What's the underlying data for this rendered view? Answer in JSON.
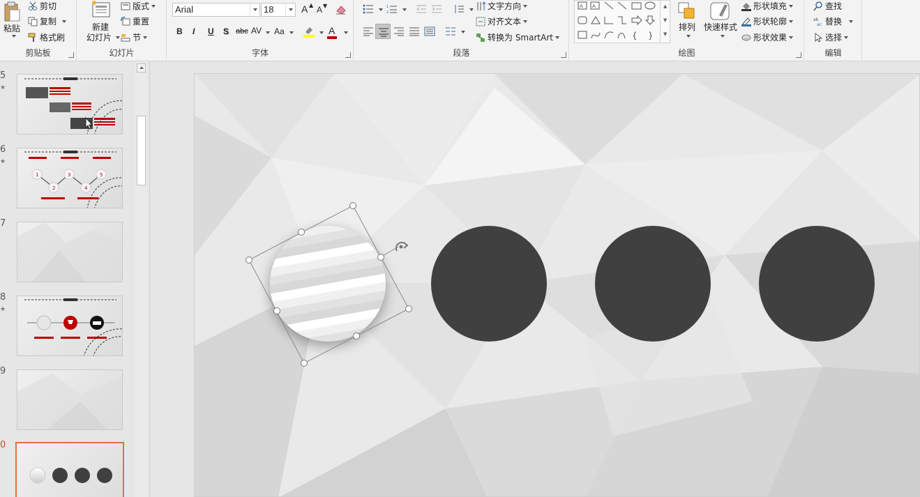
{
  "ribbon": {
    "clipboard": {
      "paste": "粘贴",
      "cut": "剪切",
      "copy": "复制",
      "format_painter": "格式刷",
      "label": "剪贴板"
    },
    "slides": {
      "new_slide_line1": "新建",
      "new_slide_line2": "幻灯片",
      "layout": "版式",
      "reset": "重置",
      "section": "节",
      "label": "幻灯片"
    },
    "font": {
      "font_name": "Arial",
      "font_size": "18",
      "bold": "B",
      "italic": "I",
      "underline": "U",
      "shadow": "S",
      "strikethrough": "abc",
      "char_spacing": "AV",
      "change_case": "Aa",
      "grow": "A",
      "shrink": "A",
      "font_color": "A",
      "label": "字体"
    },
    "paragraph": {
      "text_direction": "文字方向",
      "align_text": "对齐文本",
      "convert_smartart": "转换为 SmartArt",
      "label": "段落"
    },
    "drawing": {
      "arrange": "排列",
      "quick_styles": "快速样式",
      "shape_fill": "形状填充",
      "shape_outline": "形状轮廓",
      "shape_effects": "形状效果",
      "label": "绘图"
    },
    "editing": {
      "find": "查找",
      "replace": "替换",
      "select": "选择",
      "label": "编辑"
    }
  },
  "thumbnails": [
    {
      "num": "5",
      "star": "★"
    },
    {
      "num": "6",
      "star": "★"
    },
    {
      "num": "7",
      "star": ""
    },
    {
      "num": "8",
      "star": "★"
    },
    {
      "num": "9",
      "star": ""
    },
    {
      "num": "0",
      "star": ""
    }
  ],
  "thumb6_numbers": [
    "1",
    "2",
    "3",
    "4",
    "5"
  ],
  "colors": {
    "accent": "#e1703f",
    "dark_circle": "#404040",
    "red": "#c00000"
  }
}
